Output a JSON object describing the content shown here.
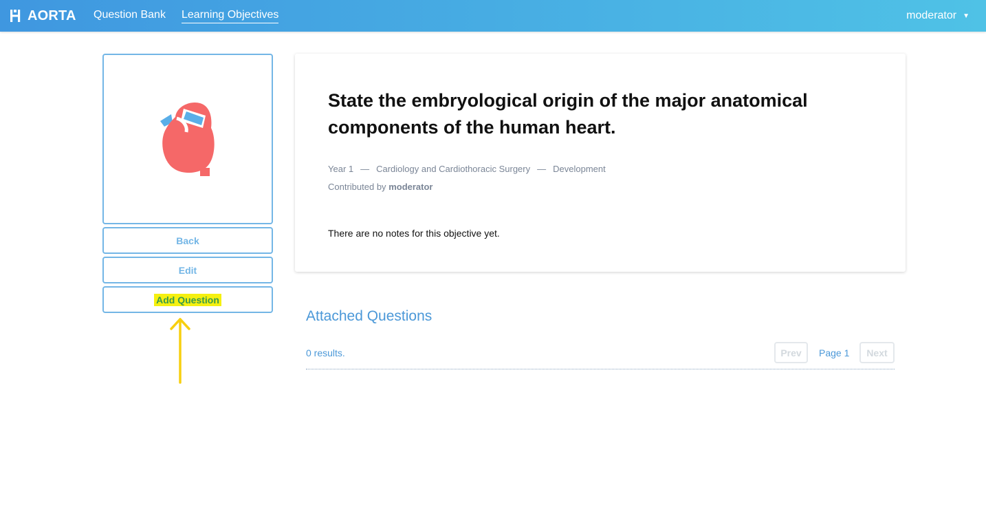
{
  "nav": {
    "brand": "AORTA",
    "links": [
      {
        "label": "Question Bank",
        "active": false
      },
      {
        "label": "Learning Objectives",
        "active": true
      }
    ],
    "user": "moderator",
    "colors": {
      "gradient_start": "#3f97e0",
      "gradient_end": "#4fc2e6"
    }
  },
  "sidebar": {
    "image_icon": "heart-icon",
    "buttons": {
      "back": "Back",
      "edit": "Edit",
      "add_question": "Add Question"
    },
    "annotation_icon": "up-arrow-icon",
    "colors": {
      "border": "#73b6e6",
      "highlight": "#f5f010",
      "highlight_text": "#3a9a4a",
      "arrow": "#f7cf10"
    }
  },
  "objective": {
    "title": "State the embryological origin of the major anatomical components of the human heart.",
    "meta": {
      "year": "Year 1",
      "separator": "—",
      "specialty": "Cardiology and Cardiothoracic Surgery",
      "topic": "Development"
    },
    "contributed_prefix": "Contributed by",
    "contributor": "moderator",
    "notes": "There are no notes for this objective yet."
  },
  "attached": {
    "title": "Attached Questions",
    "results": "0 results.",
    "pagination": {
      "prev": "Prev",
      "page": "Page 1",
      "next": "Next"
    },
    "accent": "#4b98d8"
  }
}
